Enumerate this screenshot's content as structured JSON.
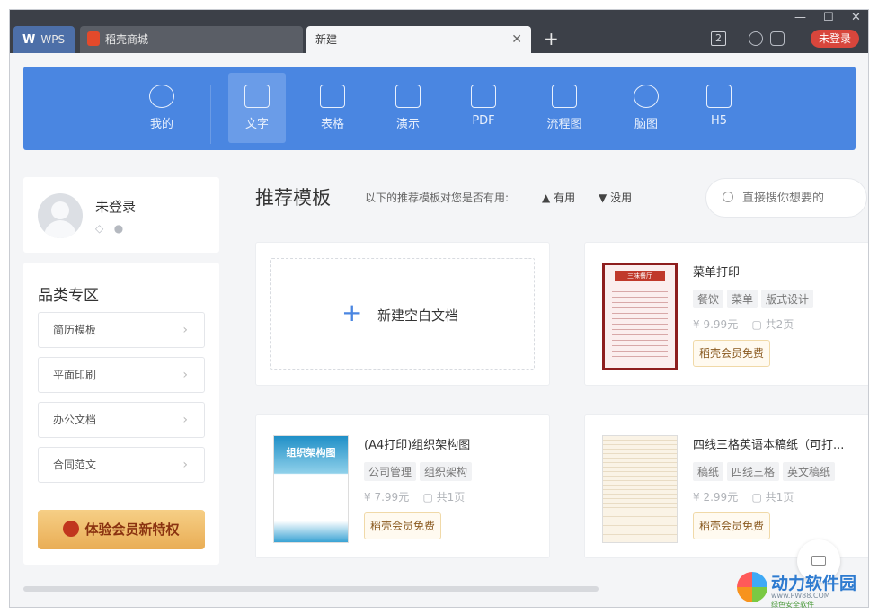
{
  "tabs": [
    {
      "label": "WPS",
      "logo": "W"
    },
    {
      "label": "稻壳商城"
    },
    {
      "label": "新建",
      "close": "✕"
    }
  ],
  "titlebar": {
    "add_tab": "+",
    "window_controls": [
      "—",
      "☐",
      "✕"
    ],
    "count_badge": "2",
    "login_label": "未登录"
  },
  "nav": {
    "items": [
      {
        "label": "我的",
        "icon": "star-icon"
      },
      {
        "label": "文字",
        "icon": "document-icon",
        "active": true
      },
      {
        "label": "表格",
        "icon": "table-icon"
      },
      {
        "label": "演示",
        "icon": "presentation-icon"
      },
      {
        "label": "PDF",
        "icon": "pdf-icon"
      },
      {
        "label": "流程图",
        "icon": "flowchart-icon"
      },
      {
        "label": "脑图",
        "icon": "mindmap-icon"
      },
      {
        "label": "H5",
        "icon": "h5-icon"
      }
    ]
  },
  "user": {
    "name": "未登录"
  },
  "categories": {
    "title": "品类专区",
    "items": [
      "简历模板",
      "平面印刷",
      "办公文档",
      "合同范文"
    ],
    "vip_label": "体验会员新特权"
  },
  "recommend": {
    "title": "推荐模板",
    "ask": "以下的推荐模板对您是否有用:",
    "yes": "有用",
    "no": "没用"
  },
  "search": {
    "placeholder": "直接搜你想要的"
  },
  "blank": {
    "plus": "+",
    "label": "新建空白文档"
  },
  "templates": [
    {
      "name": "菜单打印",
      "tags": [
        "餐饮",
        "菜单",
        "版式设计"
      ],
      "price": "9.99元",
      "pages": "共2页",
      "free": "稻壳会员免费",
      "thumb_title": "三味餐厅"
    },
    {
      "name": "(A4打印)组织架构图",
      "tags": [
        "公司管理",
        "组织架构"
      ],
      "price": "7.99元",
      "pages": "共1页",
      "free": "稻壳会员免费",
      "thumb_title": "组织架构图"
    },
    {
      "name": "四线三格英语本稿纸（可打...",
      "tags": [
        "稿纸",
        "四线三格",
        "英文稿纸"
      ],
      "price": "2.99元",
      "pages": "共1页",
      "free": "稻壳会员免费"
    }
  ],
  "watermark": {
    "text": "动力软件园",
    "site": "www.PW88.COM",
    "sub": "绿色安全软件"
  },
  "colors": {
    "nav_bg": "#4a86e1",
    "titlebar_bg": "#3c4048",
    "login_red": "#d8463c",
    "vip_gold": "#e9ad55"
  }
}
